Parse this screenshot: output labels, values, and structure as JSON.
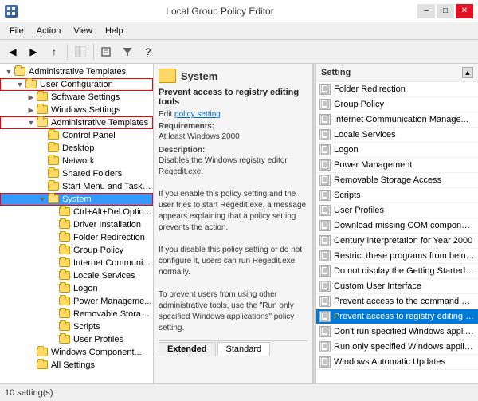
{
  "titleBar": {
    "title": "Local Group Policy Editor",
    "minBtn": "–",
    "maxBtn": "□",
    "closeBtn": "✕"
  },
  "menuBar": {
    "items": [
      "File",
      "Action",
      "View",
      "Help"
    ]
  },
  "toolbar": {
    "buttons": [
      "◀",
      "▶",
      "↑",
      "✕",
      "📋",
      "📋",
      "📋",
      "⚙",
      "◀▶",
      "?"
    ]
  },
  "tree": {
    "items": [
      {
        "indent": 0,
        "label": "Administrative Templates",
        "expanded": true,
        "open": true,
        "level": 0
      },
      {
        "indent": 1,
        "label": "User Configuration",
        "expanded": true,
        "open": true,
        "outlined": true,
        "level": 1
      },
      {
        "indent": 2,
        "label": "Software Settings",
        "expanded": false,
        "level": 2
      },
      {
        "indent": 2,
        "label": "Windows Settings",
        "expanded": false,
        "level": 2
      },
      {
        "indent": 2,
        "label": "Administrative Templates",
        "expanded": true,
        "open": true,
        "outlined": true,
        "level": 2
      },
      {
        "indent": 3,
        "label": "Control Panel",
        "level": 3
      },
      {
        "indent": 3,
        "label": "Desktop",
        "level": 3
      },
      {
        "indent": 3,
        "label": "Network",
        "level": 3
      },
      {
        "indent": 3,
        "label": "Shared Folders",
        "level": 3
      },
      {
        "indent": 3,
        "label": "Start Menu and Taskb...",
        "level": 3
      },
      {
        "indent": 3,
        "label": "System",
        "expanded": true,
        "open": true,
        "outlined": true,
        "selected": true,
        "level": 3
      },
      {
        "indent": 4,
        "label": "Ctrl+Alt+Del Optio...",
        "level": 4
      },
      {
        "indent": 4,
        "label": "Driver Installation",
        "level": 4
      },
      {
        "indent": 4,
        "label": "Folder Redirection",
        "level": 4
      },
      {
        "indent": 4,
        "label": "Group Policy",
        "level": 4
      },
      {
        "indent": 4,
        "label": "Internet Communi...",
        "level": 4
      },
      {
        "indent": 4,
        "label": "Locale Services",
        "level": 4
      },
      {
        "indent": 4,
        "label": "Logon",
        "level": 4
      },
      {
        "indent": 4,
        "label": "Power Manageme...",
        "level": 4
      },
      {
        "indent": 4,
        "label": "Removable Storage...",
        "level": 4
      },
      {
        "indent": 4,
        "label": "Scripts",
        "level": 4
      },
      {
        "indent": 4,
        "label": "User Profiles",
        "level": 4
      },
      {
        "indent": 2,
        "label": "Windows Component...",
        "level": 2
      },
      {
        "indent": 2,
        "label": "All Settings",
        "level": 2
      }
    ]
  },
  "middle": {
    "sectionTitle": "System",
    "policyTitle": "Prevent access to registry editing tools",
    "editLabel": "Edit",
    "editLink": "policy setting",
    "requirementsLabel": "Requirements:",
    "requirementsValue": "At least Windows 2000",
    "descriptionLabel": "Description:",
    "descriptionText": "Disables the Windows registry editor Regedit.exe.\n\nIf you enable this policy setting and the user tries to start Regedit.exe, a message appears explaining that a policy setting prevents the action.\n\nIf you disable this policy setting or do not configure it, users can run Regedit.exe normally.\n\nTo prevent users from using other administrative tools, use the \"Run only specified Windows applications\" policy setting.",
    "tabs": [
      "Extended",
      "Standard"
    ]
  },
  "right": {
    "headerLabel": "Setting",
    "settings": [
      {
        "name": "Folder Redirection",
        "highlighted": false
      },
      {
        "name": "Group Policy",
        "highlighted": false
      },
      {
        "name": "Internet Communication Manage...",
        "highlighted": false
      },
      {
        "name": "Locale Services",
        "highlighted": false
      },
      {
        "name": "Logon",
        "highlighted": false
      },
      {
        "name": "Power Management",
        "highlighted": false
      },
      {
        "name": "Removable Storage Access",
        "highlighted": false
      },
      {
        "name": "Scripts",
        "highlighted": false
      },
      {
        "name": "User Profiles",
        "highlighted": false
      },
      {
        "name": "Download missing COM components",
        "highlighted": false
      },
      {
        "name": "Century interpretation for Year 2000",
        "highlighted": false
      },
      {
        "name": "Restrict these programs from being lau...",
        "highlighted": false
      },
      {
        "name": "Do not display the Getting Started welc...",
        "highlighted": false
      },
      {
        "name": "Custom User Interface",
        "highlighted": false
      },
      {
        "name": "Prevent access to the command promp...",
        "highlighted": false
      },
      {
        "name": "Prevent access to registry editing tools",
        "highlighted": true
      },
      {
        "name": "Don't run specified Windows applicatio...",
        "highlighted": false
      },
      {
        "name": "Run only specified Windows applicatio...",
        "highlighted": false
      },
      {
        "name": "Windows Automatic Updates",
        "highlighted": false
      }
    ]
  },
  "statusBar": {
    "text": "10 setting(s)"
  }
}
